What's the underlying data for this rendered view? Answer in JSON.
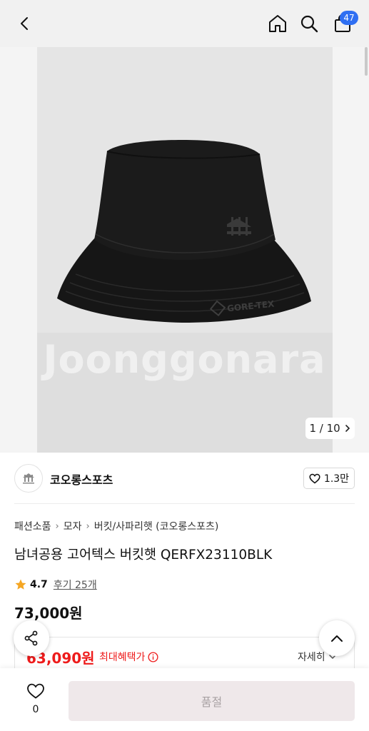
{
  "header": {
    "back_icon": "chevron-left-icon",
    "home_icon": "home-icon",
    "search_icon": "search-icon",
    "cart_icon": "shopping-bag-icon",
    "cart_count": "47"
  },
  "gallery": {
    "watermark": "Joonggonara",
    "hat_logo_text": "GORE-TEX",
    "counter": "1 / 10",
    "counter_icon": "chevron-right-icon"
  },
  "brand": {
    "name": "코오롱스포츠",
    "logo_icon": "brand-logo",
    "like_count": "1.3만",
    "like_icon": "heart-icon"
  },
  "breadcrumb": [
    "패션소품",
    "모자",
    "버킷/사파리햇 (코오롱스포츠)"
  ],
  "product": {
    "title": "남녀공용 고어텍스 버킷햇 QERFX23110BLK",
    "rating": "4.7",
    "reviews": "후기 25개",
    "price": "73,000원"
  },
  "benefit": {
    "price": "63,090원",
    "label": "최대혜택가",
    "detail": "자세히"
  },
  "bottom_bar": {
    "wish_count": "0",
    "buy_label": "품절"
  },
  "colors": {
    "accent_blue": "#2f6ff2",
    "sale_red": "#ee1b1b",
    "star": "#f5a623",
    "disabled_button": "#efe8ea"
  }
}
